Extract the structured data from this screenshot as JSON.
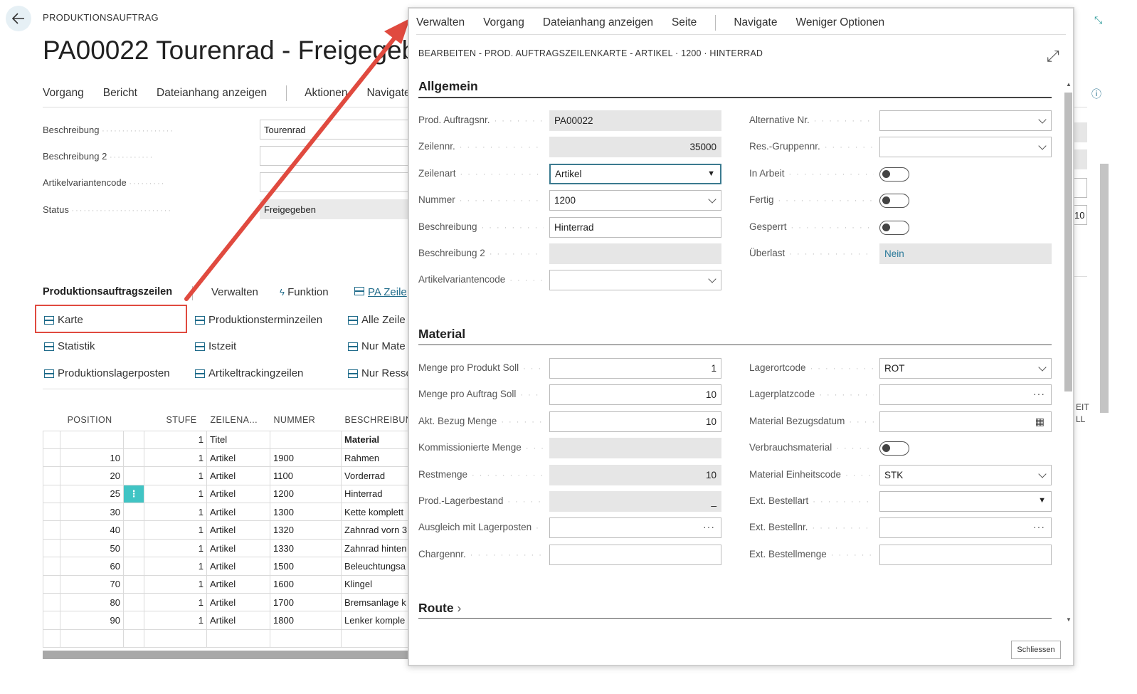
{
  "page": {
    "breadcrumb": "PRODUKTIONSAUFTRAG",
    "title": "PA00022 Tourenrad - Freigegeb",
    "actions": [
      "Vorgang",
      "Bericht",
      "Dateianhang anzeigen",
      "Aktionen",
      "Navigate"
    ],
    "fields": [
      {
        "label": "Beschreibung",
        "value": ""
      },
      {
        "label": "Beschreibung 2",
        "value": ""
      },
      {
        "label": "Artikelvariantencode",
        "value": ""
      },
      {
        "label": "Status",
        "value": "Freigegeben"
      }
    ],
    "beschreibung_value": "Tourenrad"
  },
  "lines": {
    "header": "Produktionsauftragszeilen",
    "menu": [
      "Verwalten",
      "Funktion",
      "PA Zeile"
    ],
    "actions": [
      [
        "Karte",
        "Produktionsterminzeilen",
        "Alle Zeile"
      ],
      [
        "Statistik",
        "Istzeit",
        "Nur Mate"
      ],
      [
        "Produktionslagerposten",
        "Artikeltrackingzeilen",
        "Nur Resso"
      ]
    ],
    "columns": [
      "POSITION",
      "",
      "STUFE",
      "ZEILENA...",
      "NUMMER",
      "BESCHREIBUN"
    ],
    "rows": [
      [
        "",
        "",
        "1",
        "Titel",
        "",
        "Material"
      ],
      [
        "10",
        "",
        "1",
        "Artikel",
        "1900",
        "Rahmen"
      ],
      [
        "20",
        "",
        "1",
        "Artikel",
        "1100",
        "Vorderrad"
      ],
      [
        "25",
        "⋮",
        "1",
        "Artikel",
        "1200",
        "Hinterrad"
      ],
      [
        "30",
        "",
        "1",
        "Artikel",
        "1300",
        "Kette komplett"
      ],
      [
        "40",
        "",
        "1",
        "Artikel",
        "1320",
        "Zahnrad vorn 3"
      ],
      [
        "50",
        "",
        "1",
        "Artikel",
        "1330",
        "Zahnrad hinten"
      ],
      [
        "60",
        "",
        "1",
        "Artikel",
        "1500",
        "Beleuchtungsa"
      ],
      [
        "70",
        "",
        "1",
        "Artikel",
        "1600",
        "Klingel"
      ],
      [
        "80",
        "",
        "1",
        "Artikel",
        "1700",
        "Bremsanlage k"
      ],
      [
        "90",
        "",
        "1",
        "Artikel",
        "1800",
        "Lenker komple"
      ],
      [
        "",
        "",
        "",
        "",
        "",
        ""
      ]
    ]
  },
  "right_fragment": {
    "value": "10",
    "labels": [
      "EIT",
      "LL"
    ]
  },
  "dialog": {
    "menu": [
      "Verwalten",
      "Vorgang",
      "Dateianhang anzeigen",
      "Seite",
      "Navigate",
      "Weniger Optionen"
    ],
    "breadcrumb": "BEARBEITEN - PROD. AUFTRAGSZEILENKARTE - ARTIKEL · 1200 · HINTERRAD",
    "allgemein": {
      "title": "Allgemein",
      "left": [
        {
          "label": "Prod. Auftragsnr.",
          "value": "PA00022"
        },
        {
          "label": "Zeilennr.",
          "value": "35000"
        },
        {
          "label": "Zeilenart",
          "value": "Artikel"
        },
        {
          "label": "Nummer",
          "value": "1200"
        },
        {
          "label": "Beschreibung",
          "value": "Hinterrad"
        },
        {
          "label": "Beschreibung 2",
          "value": ""
        },
        {
          "label": "Artikelvariantencode",
          "value": ""
        }
      ],
      "right": [
        {
          "label": "Alternative Nr.",
          "value": ""
        },
        {
          "label": "Res.-Gruppennr.",
          "value": ""
        },
        {
          "label": "In Arbeit",
          "value": "off"
        },
        {
          "label": "Fertig",
          "value": "off"
        },
        {
          "label": "Gesperrt",
          "value": "off"
        },
        {
          "label": "Überlast",
          "value": "Nein"
        }
      ]
    },
    "material": {
      "title": "Material",
      "left": [
        {
          "label": "Menge pro Produkt Soll",
          "value": "1"
        },
        {
          "label": "Menge pro Auftrag Soll",
          "value": "10"
        },
        {
          "label": "Akt. Bezug Menge",
          "value": "10"
        },
        {
          "label": "Kommissionierte Menge",
          "value": ""
        },
        {
          "label": "Restmenge",
          "value": "10"
        },
        {
          "label": "Prod.-Lagerbestand",
          "value": "_"
        },
        {
          "label": "Ausgleich mit Lagerposten",
          "value": ""
        },
        {
          "label": "Chargennr.",
          "value": ""
        }
      ],
      "right": [
        {
          "label": "Lagerortcode",
          "value": "ROT"
        },
        {
          "label": "Lagerplatzcode",
          "value": ""
        },
        {
          "label": "Material Bezugsdatum",
          "value": ""
        },
        {
          "label": "Verbrauchsmaterial",
          "value": "off"
        },
        {
          "label": "Material Einheitscode",
          "value": "STK"
        },
        {
          "label": "Ext. Bestellart",
          "value": ""
        },
        {
          "label": "Ext. Bestellnr.",
          "value": ""
        },
        {
          "label": "Ext. Bestellmenge",
          "value": ""
        }
      ]
    },
    "route": {
      "title": "Route"
    },
    "close_label": "Schliessen"
  },
  "colors": {
    "highlight": "#e04a3f",
    "accent": "#1f6b8a",
    "selected_cell": "#40c4c4"
  }
}
